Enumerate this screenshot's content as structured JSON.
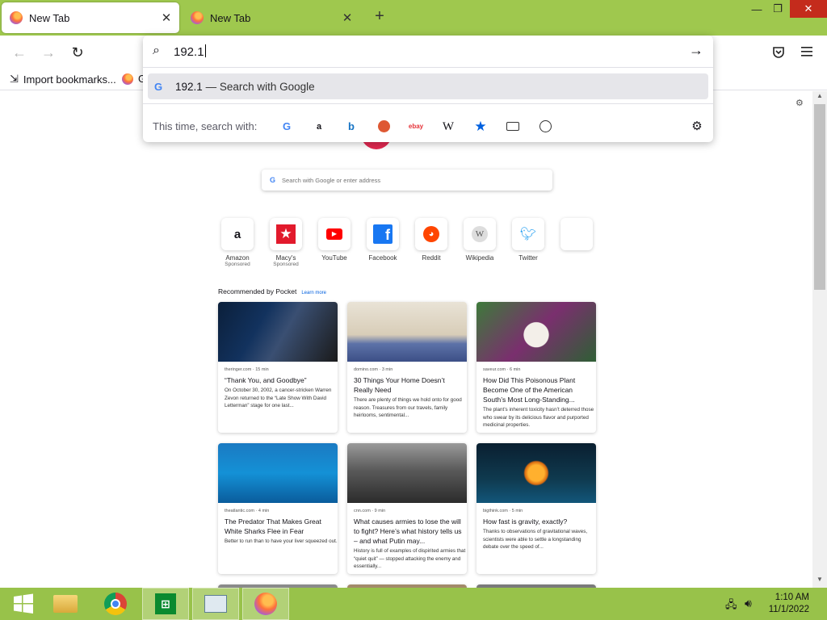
{
  "tabs": [
    {
      "label": "New Tab",
      "active": true
    },
    {
      "label": "New Tab",
      "active": false
    }
  ],
  "toolbar": {
    "url_value": "192.1"
  },
  "bookmarks": [
    {
      "label": "Import bookmarks..."
    },
    {
      "label": "G"
    }
  ],
  "urlbar": {
    "suggestion_query": "192.1",
    "suggestion_suffix": "— Search with Google",
    "this_time_label": "This time, search with:"
  },
  "engines": [
    "google-icon",
    "amazon-icon",
    "bing-icon",
    "duckduckgo-icon",
    "ebay-icon",
    "wikipedia-icon",
    "bookmarks-star-icon",
    "tabs-icon",
    "history-icon"
  ],
  "newtab": {
    "search_placeholder": "Search with Google or enter address",
    "pocket_title": "Recommended by Pocket",
    "learn_more": "Learn more"
  },
  "sites": [
    {
      "label": "Amazon",
      "sponsored": "Sponsored"
    },
    {
      "label": "Macy's",
      "sponsored": "Sponsored"
    },
    {
      "label": "YouTube",
      "sponsored": ""
    },
    {
      "label": "Facebook",
      "sponsored": ""
    },
    {
      "label": "Reddit",
      "sponsored": ""
    },
    {
      "label": "Wikipedia",
      "sponsored": ""
    },
    {
      "label": "Twitter",
      "sponsored": ""
    }
  ],
  "cards": [
    {
      "source": "theringer.com · 15 min",
      "title": "“Thank You, and Goodbye”",
      "excerpt": "On October 30, 2002, a cancer-stricken Warren Zevon returned to the “Late Show With David Letterman” stage for one last..."
    },
    {
      "source": "domino.com · 3 min",
      "title": "30 Things Your Home Doesn’t Really Need",
      "excerpt": "There are plenty of things we hold onto for good reason. Treasures from our travels, family heirlooms, sentimental..."
    },
    {
      "source": "saveur.com · 6 min",
      "title": "How Did This Poisonous Plant Become One of the American South’s Most Long-Standing...",
      "excerpt": "The plant’s inherent toxicity hasn’t deterred those who swear by its delicious flavor and purported medicinal properties."
    },
    {
      "source": "theatlantic.com · 4 min",
      "title": "The Predator That Makes Great White Sharks Flee in Fear",
      "excerpt": "Better to run than to have your liver squeezed out."
    },
    {
      "source": "cnn.com · 9 min",
      "title": "What causes armies to lose the will to fight? Here’s what history tells us – and what Putin may...",
      "excerpt": "History is full of examples of dispirited armies that “quiet quit” — stopped attacking the enemy and essentially..."
    },
    {
      "source": "bigthink.com · 5 min",
      "title": "How fast is gravity, exactly?",
      "excerpt": "Thanks to observations of gravitational waves, scientists were able to settle a longstanding debate over the speed of..."
    }
  ],
  "taskbar": {
    "time": "1:10 AM",
    "date": "11/1/2022"
  }
}
